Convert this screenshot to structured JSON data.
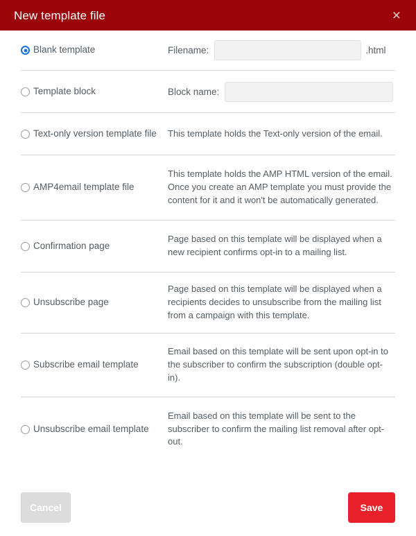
{
  "dialog": {
    "title": "New template file",
    "close_icon": "close-icon",
    "close_glyph": "×"
  },
  "colors": {
    "header_bg": "#9b0408",
    "save_bg": "#e8202a",
    "cancel_bg": "#dcdcdc",
    "radio_selected": "#1a73d4",
    "text": "#555c63",
    "divider": "#d5d5d5",
    "input_bg": "#f2f2f2"
  },
  "options": [
    {
      "id": "blank-template",
      "label": "Blank template",
      "selected": true,
      "field_label": "Filename:",
      "field_value": "",
      "field_placeholder": "",
      "suffix": ".html",
      "description": ""
    },
    {
      "id": "template-block",
      "label": "Template block",
      "selected": false,
      "field_label": "Block name:",
      "field_value": "",
      "field_placeholder": "",
      "suffix": "",
      "description": ""
    },
    {
      "id": "text-only-version-template-file",
      "label": "Text-only version template file",
      "selected": false,
      "description": "This template holds the Text-only version of the email."
    },
    {
      "id": "amp4email-template-file",
      "label": "AMP4email template file",
      "selected": false,
      "description": "This template holds the AMP HTML version of the email. Once you create an AMP template you must provide the content for it and it won't be automatically generated."
    },
    {
      "id": "confirmation-page",
      "label": "Confirmation page",
      "selected": false,
      "description": "Page based on this template will be displayed when a new recipient confirms opt-in to a mailing list."
    },
    {
      "id": "unsubscribe-page",
      "label": "Unsubscribe page",
      "selected": false,
      "description": "Page based on this template will be displayed when a recipients decides to unsubscribe from the mailing list from a campaign with this template."
    },
    {
      "id": "subscribe-email-template",
      "label": "Subscribe email template",
      "selected": false,
      "description": "Email based on this template will be sent upon opt-in to the subscriber to confirm the subscription (double opt-in)."
    },
    {
      "id": "unsubscribe-email-template",
      "label": "Unsubscribe email template",
      "selected": false,
      "description": "Email based on this template will be sent to the subscriber to confirm the mailing list removal after opt-out."
    }
  ],
  "footer": {
    "cancel_label": "Cancel",
    "save_label": "Save"
  }
}
